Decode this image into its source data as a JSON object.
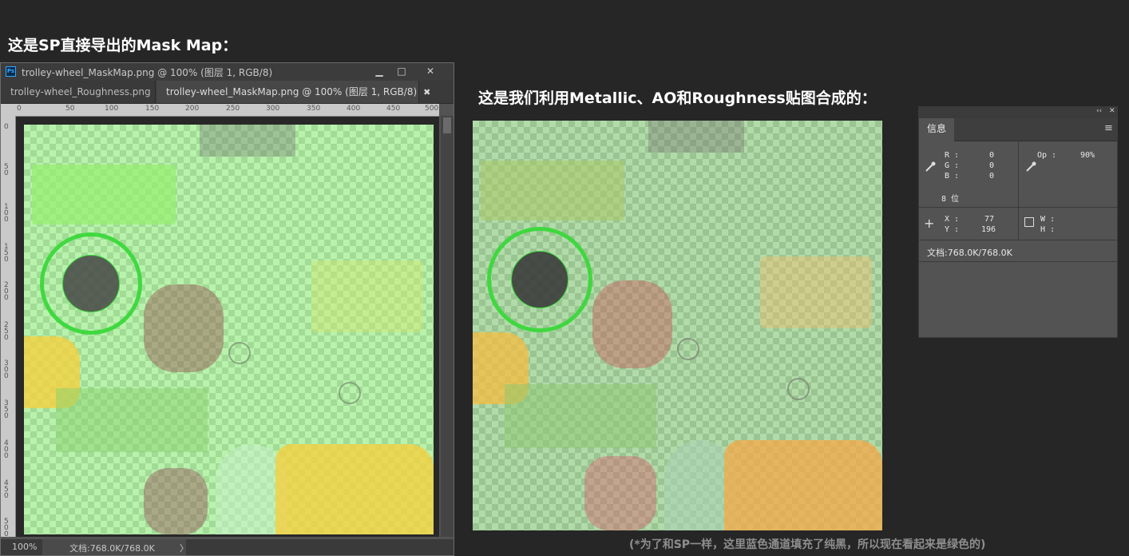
{
  "headings": {
    "left": "这是SP直接导出的Mask Map：",
    "right": "这是我们利用Metallic、AO和Roughness贴图合成的："
  },
  "ps_window": {
    "logo": "Ps",
    "title": "trolley-wheel_MaskMap.png @ 100% (图层 1, RGB/8)",
    "controls": {
      "minimize": "▁",
      "maximize": "□",
      "close": "✕"
    },
    "tabs": [
      {
        "label": "trolley-wheel_Roughness.png",
        "close": "✖"
      },
      {
        "label": "trolley-wheel_MaskMap.png @ 100% (图层 1, RGB/8)",
        "close": "✖"
      }
    ],
    "ruler_h": [
      "0",
      "50",
      "100",
      "150",
      "200",
      "250",
      "300",
      "350",
      "400",
      "450",
      "500"
    ],
    "ruler_v": [
      "0",
      "50",
      "100",
      "150",
      "200",
      "250",
      "300",
      "350",
      "400",
      "450",
      "500"
    ],
    "status": {
      "zoom": "100%",
      "doc": "文档:768.0K/768.0K",
      "arrow": "〉"
    }
  },
  "info_panel": {
    "header_icons": {
      "collapse": "‹‹",
      "close": "✕"
    },
    "tab": "信息",
    "menu_icon": "≡",
    "r_label": "R :",
    "r_value": "0",
    "g_label": "G :",
    "g_value": "0",
    "b_label": "B :",
    "b_value": "0",
    "bit": "8 位",
    "op_label": "Op :",
    "op_value": "90%",
    "x_label": "X :",
    "x_value": "77",
    "y_label": "Y :",
    "y_value": "196",
    "w_label": "W :",
    "h_label": "H :",
    "doc": "文档:768.0K/768.0K"
  },
  "footnote": "(*为了和SP一样，这里蓝色通道填充了纯黑，所以现在看起来是绿色的)",
  "colors": {
    "background": "#262626",
    "ps_chrome": "#535353",
    "mask_green": "#7de86a",
    "ring_green": "#3ad83a",
    "yellow": "#f5d040",
    "red_brown": "#a0605a"
  }
}
